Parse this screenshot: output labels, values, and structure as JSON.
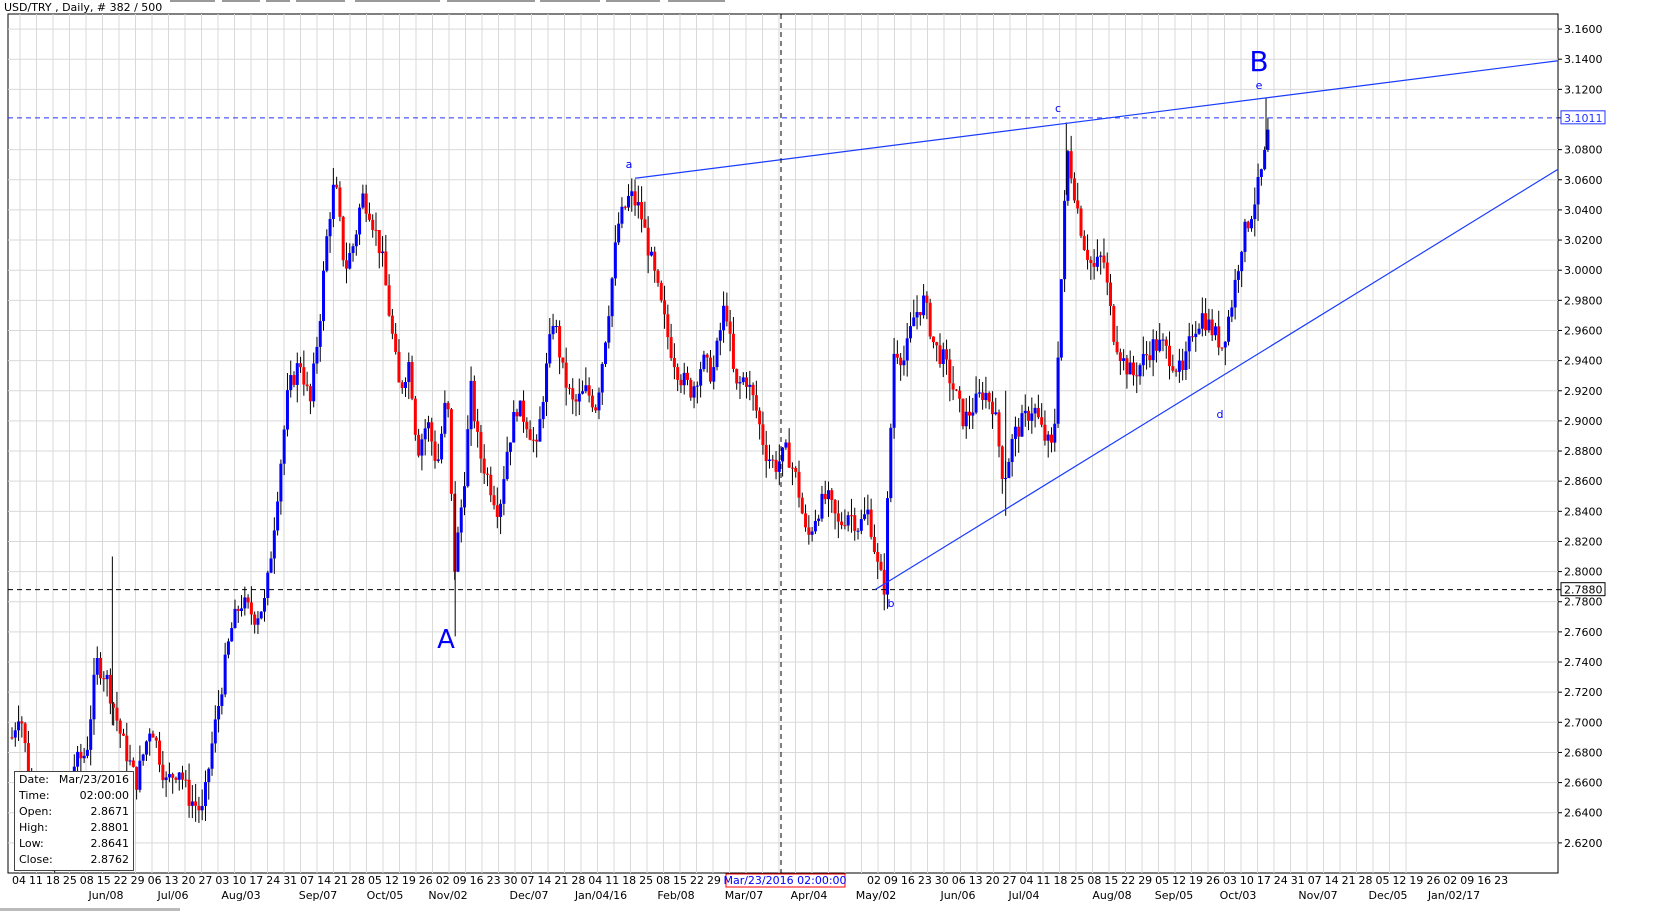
{
  "header": {
    "title": "USD/TRY , Daily, # 382 / 500"
  },
  "colors": {
    "bull": "#0000ff",
    "bear": "#ff0000",
    "wick": "#000000",
    "grid": "#d9d9d9",
    "trendline": "#1a3cff",
    "resistance": "#2233ff",
    "support": "#000000"
  },
  "chart_data": {
    "type": "candlestick",
    "title": "USD/TRY , Daily, # 382 / 500",
    "y_range": [
      2.6,
      3.17
    ],
    "y_ticks": [
      "3.1600",
      "3.1400",
      "3.1200",
      "3.1011",
      "3.0800",
      "3.0600",
      "3.0400",
      "3.0200",
      "3.0000",
      "2.9800",
      "2.9600",
      "2.9400",
      "2.9200",
      "2.9000",
      "2.8800",
      "2.8600",
      "2.8400",
      "2.8200",
      "2.8000",
      "2.7880",
      "2.7800",
      "2.7600",
      "2.7400",
      "2.7200",
      "2.7000",
      "2.6800",
      "2.6600",
      "2.6400",
      "2.6200"
    ],
    "y_tick_values": [
      3.16,
      3.14,
      3.12,
      3.1011,
      3.08,
      3.06,
      3.04,
      3.02,
      3.0,
      2.98,
      2.96,
      2.94,
      2.92,
      2.9,
      2.88,
      2.86,
      2.84,
      2.82,
      2.8,
      2.788,
      2.78,
      2.76,
      2.74,
      2.72,
      2.7,
      2.68,
      2.66,
      2.64,
      2.62
    ],
    "highlighted_levels": [
      {
        "label": "3.1011",
        "value": 3.1011,
        "color": "#2233ff",
        "style": "dashed"
      },
      {
        "label": "2.7880",
        "value": 2.788,
        "color": "#000000",
        "style": "dashed"
      }
    ],
    "x_tick_labels": [
      "04",
      "11",
      "18",
      "25",
      "08",
      "15",
      "22",
      "29",
      "06",
      "13",
      "20",
      "27",
      "03",
      "10",
      "17",
      "24",
      "31",
      "07",
      "14",
      "21",
      "28",
      "05",
      "12",
      "19",
      "26",
      "02",
      "09",
      "16",
      "23",
      "30",
      "07",
      "14",
      "21",
      "28",
      "04",
      "11",
      "18",
      "25",
      "08",
      "15",
      "22",
      "29",
      "Mar/23/2016 02:00:00",
      "02",
      "09",
      "16",
      "23",
      "30",
      "06",
      "13",
      "20",
      "27",
      "04",
      "11",
      "18",
      "25",
      "08",
      "15",
      "22",
      "29",
      "05",
      "12",
      "19",
      "26",
      "03",
      "10",
      "17",
      "24",
      "31",
      "07",
      "14",
      "21",
      "28",
      "05",
      "12",
      "19",
      "26",
      "02",
      "09",
      "16",
      "23"
    ],
    "x_month_labels": [
      "Jun/08",
      "Jul/06",
      "Aug/03",
      "Sep/07",
      "Oct/05",
      "Nov/02",
      "Dec/07",
      "Jan/04/16",
      "Feb/08",
      "Mar/07",
      "Apr/04",
      "May/02",
      "Jun/06",
      "Jul/04",
      "Aug/08",
      "Sep/05",
      "Oct/03",
      "Nov/07",
      "Dec/05",
      "Jan/02/17"
    ],
    "cursor_date": "Mar/23/2016 02:00:00",
    "price_path": [
      [
        0,
        2.69
      ],
      [
        8,
        2.71
      ],
      [
        18,
        2.66
      ],
      [
        30,
        2.62
      ],
      [
        42,
        2.6
      ],
      [
        50,
        2.62
      ],
      [
        60,
        2.67
      ],
      [
        75,
        2.68
      ],
      [
        85,
        2.74
      ],
      [
        95,
        2.73
      ],
      [
        110,
        2.69
      ],
      [
        125,
        2.66
      ],
      [
        140,
        2.7
      ],
      [
        155,
        2.66
      ],
      [
        168,
        2.67
      ],
      [
        178,
        2.65
      ],
      [
        192,
        2.64
      ],
      [
        200,
        2.68
      ],
      [
        210,
        2.72
      ],
      [
        220,
        2.76
      ],
      [
        230,
        2.78
      ],
      [
        245,
        2.77
      ],
      [
        255,
        2.78
      ],
      [
        262,
        2.82
      ],
      [
        270,
        2.87
      ],
      [
        278,
        2.92
      ],
      [
        290,
        2.94
      ],
      [
        300,
        2.91
      ],
      [
        310,
        2.97
      ],
      [
        318,
        3.03
      ],
      [
        325,
        3.06
      ],
      [
        335,
        3.0
      ],
      [
        345,
        3.02
      ],
      [
        352,
        3.05
      ],
      [
        360,
        3.04
      ],
      [
        372,
        3.01
      ],
      [
        380,
        2.97
      ],
      [
        390,
        2.92
      ],
      [
        400,
        2.94
      ],
      [
        408,
        2.88
      ],
      [
        418,
        2.9
      ],
      [
        428,
        2.87
      ],
      [
        438,
        2.92
      ],
      [
        445,
        2.8
      ],
      [
        455,
        2.86
      ],
      [
        462,
        2.92
      ],
      [
        470,
        2.88
      ],
      [
        480,
        2.86
      ],
      [
        490,
        2.84
      ],
      [
        498,
        2.88
      ],
      [
        508,
        2.91
      ],
      [
        518,
        2.9
      ],
      [
        528,
        2.88
      ],
      [
        535,
        2.92
      ],
      [
        545,
        2.97
      ],
      [
        555,
        2.93
      ],
      [
        565,
        2.91
      ],
      [
        578,
        2.92
      ],
      [
        588,
        2.91
      ],
      [
        598,
        2.96
      ],
      [
        610,
        3.03
      ],
      [
        622,
        3.05
      ],
      [
        632,
        3.04
      ],
      [
        642,
        3.01
      ],
      [
        652,
        2.98
      ],
      [
        662,
        2.95
      ],
      [
        672,
        2.93
      ],
      [
        684,
        2.92
      ],
      [
        695,
        2.94
      ],
      [
        705,
        2.93
      ],
      [
        718,
        2.98
      ],
      [
        728,
        2.92
      ],
      [
        738,
        2.93
      ],
      [
        748,
        2.91
      ],
      [
        758,
        2.88
      ],
      [
        768,
        2.87
      ],
      [
        780,
        2.88
      ],
      [
        790,
        2.86
      ],
      [
        800,
        2.82
      ],
      [
        810,
        2.84
      ],
      [
        820,
        2.85
      ],
      [
        832,
        2.83
      ],
      [
        842,
        2.84
      ],
      [
        852,
        2.83
      ],
      [
        862,
        2.84
      ],
      [
        872,
        2.8
      ],
      [
        878,
        2.79
      ],
      [
        882,
        2.86
      ],
      [
        888,
        2.95
      ],
      [
        898,
        2.94
      ],
      [
        908,
        2.97
      ],
      [
        918,
        2.98
      ],
      [
        928,
        2.95
      ],
      [
        938,
        2.94
      ],
      [
        948,
        2.92
      ],
      [
        958,
        2.9
      ],
      [
        968,
        2.91
      ],
      [
        978,
        2.92
      ],
      [
        988,
        2.91
      ],
      [
        998,
        2.86
      ],
      [
        1008,
        2.89
      ],
      [
        1018,
        2.9
      ],
      [
        1028,
        2.91
      ],
      [
        1038,
        2.89
      ],
      [
        1048,
        2.88
      ],
      [
        1055,
        2.98
      ],
      [
        1062,
        3.08
      ],
      [
        1070,
        3.05
      ],
      [
        1078,
        3.02
      ],
      [
        1088,
        3.0
      ],
      [
        1098,
        3.01
      ],
      [
        1108,
        2.96
      ],
      [
        1118,
        2.94
      ],
      [
        1128,
        2.93
      ],
      [
        1138,
        2.94
      ],
      [
        1148,
        2.95
      ],
      [
        1158,
        2.95
      ],
      [
        1168,
        2.94
      ],
      [
        1178,
        2.93
      ],
      [
        1188,
        2.96
      ],
      [
        1198,
        2.97
      ],
      [
        1208,
        2.96
      ],
      [
        1218,
        2.95
      ],
      [
        1228,
        2.98
      ],
      [
        1238,
        3.02
      ],
      [
        1248,
        3.04
      ],
      [
        1256,
        3.06
      ],
      [
        1262,
        3.08
      ],
      [
        1266,
        3.1
      ]
    ],
    "annotations": [
      {
        "label": "A",
        "size": "large"
      },
      {
        "label": "B",
        "size": "large"
      },
      {
        "label": "a",
        "size": "small"
      },
      {
        "label": "b",
        "size": "small"
      },
      {
        "label": "c",
        "size": "small"
      },
      {
        "label": "d",
        "size": "small"
      },
      {
        "label": "e",
        "size": "small"
      }
    ]
  },
  "info_panel": {
    "rows": [
      {
        "label": "Date:",
        "value": "Mar/23/2016"
      },
      {
        "label": "Time:",
        "value": "02:00:00"
      },
      {
        "label": "Open:",
        "value": "2.8671"
      },
      {
        "label": "High:",
        "value": "2.8801"
      },
      {
        "label": "Low:",
        "value": "2.8641"
      },
      {
        "label": "Close:",
        "value": "2.8762"
      }
    ]
  }
}
